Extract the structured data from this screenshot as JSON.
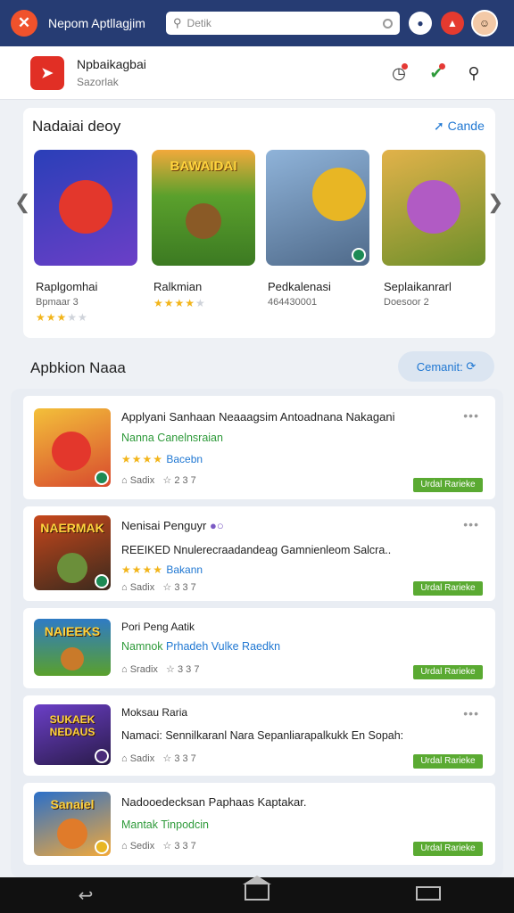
{
  "header": {
    "app_title": "Nepom Aptllagjim",
    "search_placeholder": "Detik",
    "logo_glyph": "✕"
  },
  "developer": {
    "name": "Npbaikagbai",
    "subtitle": "Sazorlak"
  },
  "featured": {
    "title": "Nadaiai deoy",
    "see_all": "Cande",
    "games": [
      {
        "name": "Raplgomhai",
        "meta": "Bpmaar 3",
        "rating": 3.5,
        "thumb_title": "",
        "bg": "#3b4ec9",
        "accent": "#e3372c"
      },
      {
        "name": "Ralkmian",
        "meta": "",
        "rating": 4.5,
        "thumb_title": "BAWAIDAI",
        "bg": "#5aa02c",
        "accent": "#8a5a26"
      },
      {
        "name": "Pedkalenasi",
        "meta": "464430001",
        "rating": null,
        "thumb_title": "",
        "bg": "#8fb3d9",
        "accent": "#e8b624"
      },
      {
        "name": "Seplaikanrarl",
        "meta": "Doesoor 2",
        "rating": null,
        "thumb_title": "",
        "bg": "#c9a13b",
        "accent": "#b15bc4"
      }
    ]
  },
  "list": {
    "title": "Apbkion Naaa",
    "button": "Cemanit:",
    "items": [
      {
        "title": "Applyani Sanhaan Neaaagsim Antoadnana Nakagani",
        "sub": "Nanna Canelnsraian",
        "sub_blue": "",
        "rating_text": "Bacebn",
        "stars": 4,
        "meta1": "Sadix",
        "meta2": "2 3 7",
        "tag": "Urdal Rarieke",
        "thumb": "",
        "bg": "#d84a2e"
      },
      {
        "title": "Nenisai Penguyr",
        "sub": "REEIKED Nnulerecraadandeag Gamnienleom Salcra..",
        "sub_blue": "",
        "rating_text": "Bakann",
        "stars": 4,
        "meta1": "Sadix",
        "meta2": "3 3 7",
        "tag": "Urdal Rarieke",
        "thumb": "NAERMAK",
        "bg": "#3b2a1d"
      },
      {
        "title": "Pori Peng Aatik",
        "sub": "Namnok",
        "sub_blue": "Prhadeh Vulke Raedkn",
        "rating_text": "",
        "stars": 0,
        "meta1": "Sradix",
        "meta2": "3 3 7",
        "tag": "Urdal Rarieke",
        "thumb": "NAIEEKS",
        "bg": "#2f7bc4"
      },
      {
        "title": "Moksau Raria",
        "sub": "Namaci: Sennilkaranl Nara Sepanliarapalkukk En Sopah:",
        "sub_blue": "",
        "rating_text": "",
        "stars": 0,
        "meta1": "Sadix",
        "meta2": "3 3 7",
        "tag": "Urdal Rarieke",
        "thumb": "SUKAEK NEDAUS",
        "bg": "#4a2b7a"
      },
      {
        "title": "Nadooedecksan Paphaas Kaptakar.",
        "sub": "Mantak Tinpodcin",
        "sub_blue": "",
        "rating_text": "",
        "stars": 0,
        "meta1": "Sedix",
        "meta2": "3 3 7",
        "tag": "Urdal Rarieke",
        "thumb": "Sanaiel",
        "bg": "#2a6fc9"
      }
    ]
  },
  "nav": {
    "back": "↩",
    "home": "",
    "recents": ""
  }
}
